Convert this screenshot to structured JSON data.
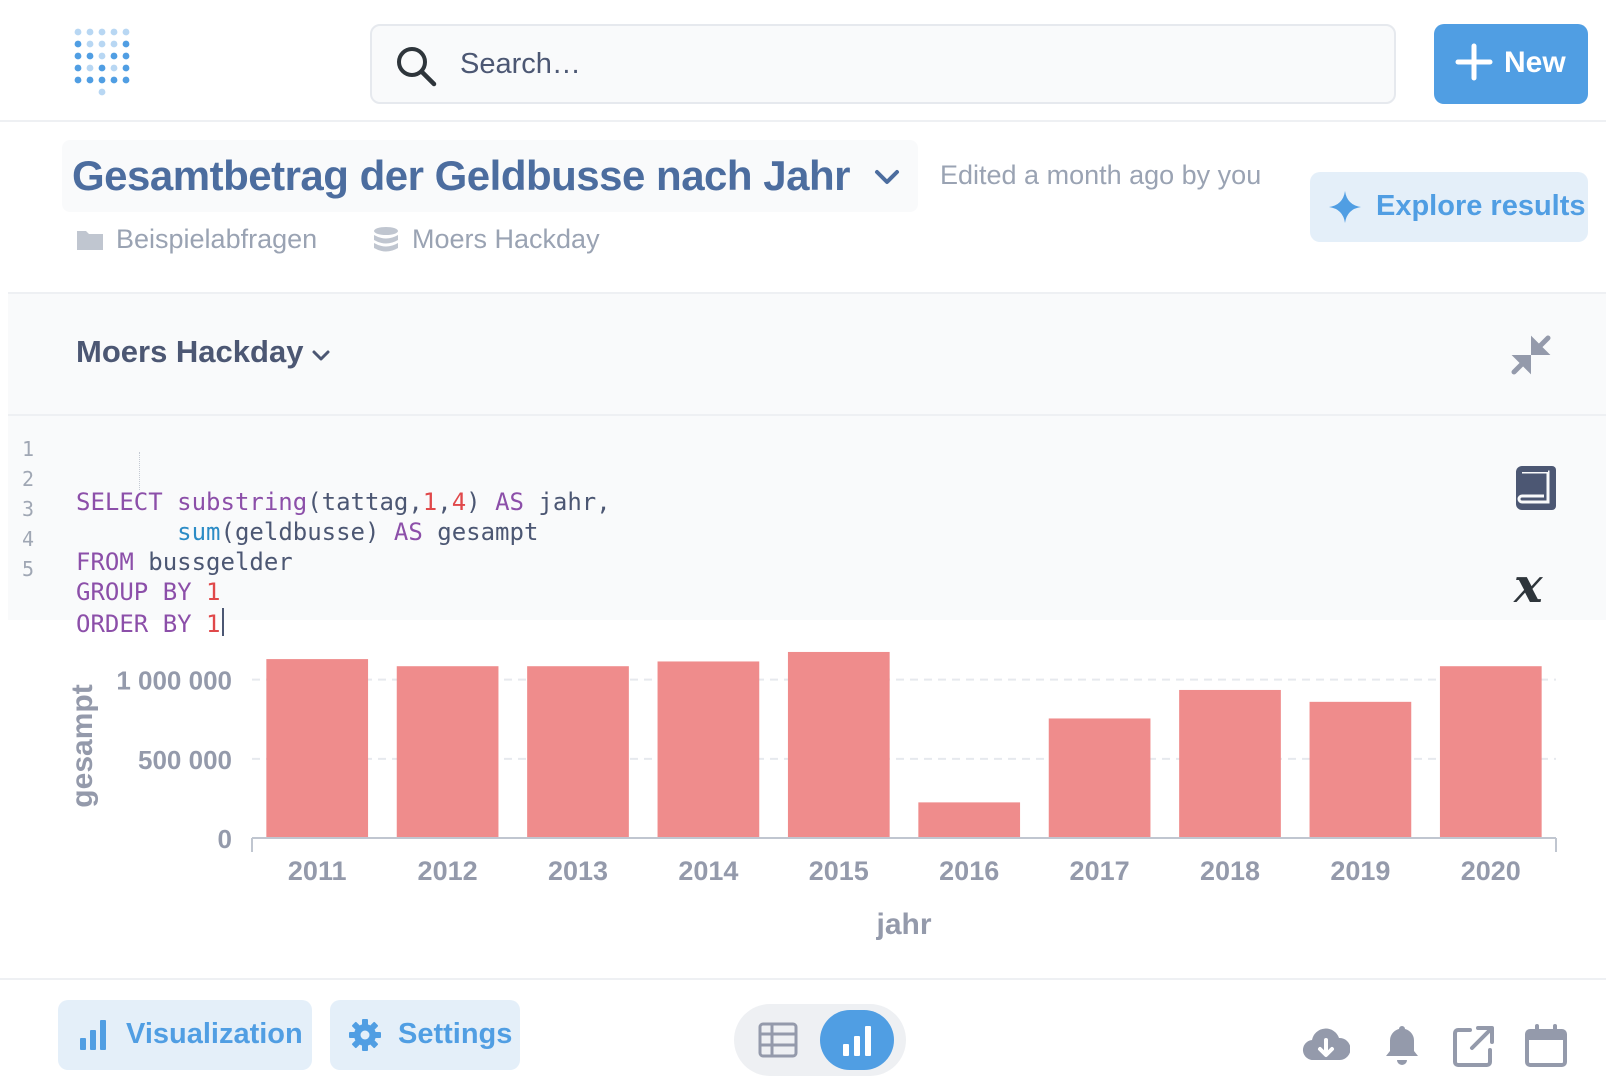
{
  "header": {
    "logo_icon": "metabase-logo-icon",
    "search_placeholder": "Search…",
    "new_button_label": "New"
  },
  "question": {
    "title": "Gesamtbetrag der Geldbusse nach Jahr",
    "edited_text": "Edited a month ago by you",
    "collection": "Beispielabfragen",
    "database": "Moers Hackday",
    "explore_label": "Explore results"
  },
  "editor": {
    "database_selector": "Moers Hackday",
    "lines": [
      {
        "num": "1"
      },
      {
        "num": "2"
      },
      {
        "num": "3"
      },
      {
        "num": "4"
      },
      {
        "num": "5"
      }
    ],
    "sql": "SELECT substring(tattag,1,4) AS jahr,\n       sum(geldbusse) AS gesampt\nFROM bussgelder\nGROUP BY 1\nORDER BY 1"
  },
  "chart_data": {
    "type": "bar",
    "categories": [
      "2011",
      "2012",
      "2013",
      "2014",
      "2015",
      "2016",
      "2017",
      "2018",
      "2019",
      "2020"
    ],
    "values": [
      1130000,
      1085000,
      1085000,
      1115000,
      1175000,
      225000,
      755000,
      935000,
      860000,
      1085000
    ],
    "xlabel": "jahr",
    "ylabel": "gesampt",
    "ylim": [
      0,
      1200000
    ],
    "yticks": [
      0,
      500000,
      1000000
    ],
    "ytick_labels": [
      "0",
      "500 000",
      "1 000 000"
    ],
    "grid": true,
    "bar_color": "#ef8c8c"
  },
  "footer": {
    "visualization_label": "Visualization",
    "settings_label": "Settings"
  },
  "colors": {
    "brand": "#509ee3",
    "title": "#4c6d9f",
    "bar": "#ef8c8c"
  }
}
